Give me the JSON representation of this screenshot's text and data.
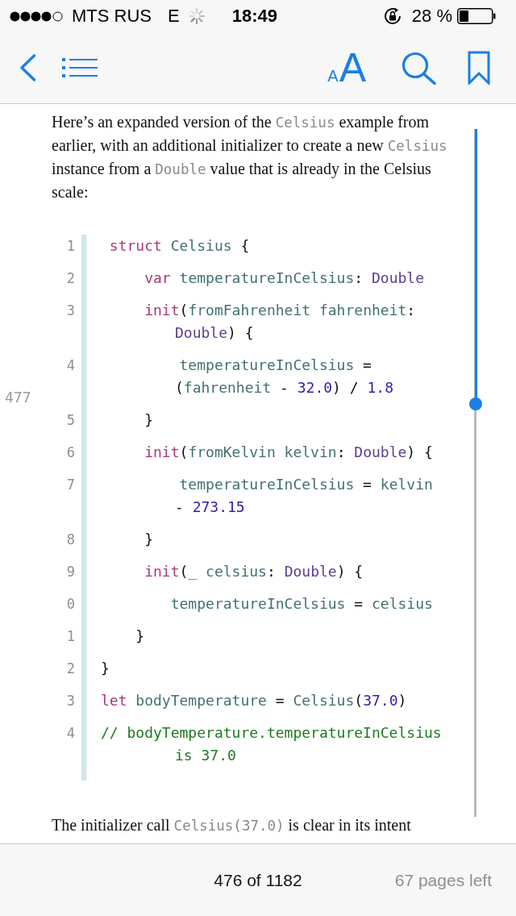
{
  "status_bar": {
    "carrier": "MTS RUS",
    "network": "E",
    "time": "18:49",
    "battery": "28 %"
  },
  "toolbar": {
    "text_size_button": {
      "small": "A",
      "large": "A"
    }
  },
  "page": {
    "blocks": [
      {
        "kind": "paragraph",
        "segments": [
          {
            "kind": "text",
            "text": "Here’s an expanded version of the "
          },
          {
            "kind": "code",
            "text": "Celsius"
          },
          {
            "kind": "text",
            "text": " example from earlier, with an additional initializer to create a new "
          },
          {
            "kind": "code",
            "text": "Celsius"
          },
          {
            "kind": "text",
            "text": " instance from a "
          },
          {
            "kind": "code",
            "text": "Double"
          },
          {
            "kind": "text",
            "text": " value that is already in the Celsius scale:"
          }
        ]
      },
      {
        "kind": "code",
        "lines": [
          {
            "number": "1",
            "rows": [
              {
                "tokens": [
                  {
                    "kind": "keyword",
                    "text": " struct"
                  },
                  {
                    "kind": "ident",
                    "text": " Celsius"
                  },
                  {
                    "kind": "plain",
                    "text": " {"
                  }
                ]
              }
            ]
          },
          {
            "number": "2",
            "rows": [
              {
                "tokens": [
                  {
                    "kind": "keyword",
                    "text": "     var"
                  },
                  {
                    "kind": "ident",
                    "text": " temperatureInCelsius"
                  },
                  {
                    "kind": "plain",
                    "text": ": "
                  },
                  {
                    "kind": "type",
                    "text": "Double"
                  }
                ]
              }
            ]
          },
          {
            "number": "3",
            "rows": [
              {
                "tokens": [
                  {
                    "kind": "keyword",
                    "text": "     init"
                  },
                  {
                    "kind": "plain",
                    "text": "("
                  },
                  {
                    "kind": "ident",
                    "text": "fromFahrenheit"
                  },
                  {
                    "kind": "ident",
                    "text": " fahrenheit"
                  },
                  {
                    "kind": "plain",
                    "text": ":"
                  }
                ]
              },
              {
                "tokens": [
                  {
                    "kind": "type",
                    "text": "Double"
                  },
                  {
                    "kind": "plain",
                    "text": ") {"
                  }
                ]
              }
            ]
          },
          {
            "number": "4",
            "rows": [
              {
                "tokens": [
                  {
                    "kind": "ident",
                    "text": "         temperatureInCelsius"
                  },
                  {
                    "kind": "plain",
                    "text": " ="
                  }
                ]
              },
              {
                "tokens": [
                  {
                    "kind": "plain",
                    "text": "("
                  },
                  {
                    "kind": "ident",
                    "text": "fahrenheit"
                  },
                  {
                    "kind": "plain",
                    "text": " - "
                  },
                  {
                    "kind": "number",
                    "text": "32.0"
                  },
                  {
                    "kind": "plain",
                    "text": ") / "
                  },
                  {
                    "kind": "number",
                    "text": "1.8"
                  }
                ]
              }
            ]
          },
          {
            "number": "5",
            "rows": [
              {
                "tokens": [
                  {
                    "kind": "plain",
                    "text": "     }"
                  }
                ]
              }
            ]
          },
          {
            "number": "6",
            "rows": [
              {
                "tokens": [
                  {
                    "kind": "keyword",
                    "text": "     init"
                  },
                  {
                    "kind": "plain",
                    "text": "("
                  },
                  {
                    "kind": "ident",
                    "text": "fromKelvin"
                  },
                  {
                    "kind": "ident",
                    "text": " kelvin"
                  },
                  {
                    "kind": "plain",
                    "text": ": "
                  },
                  {
                    "kind": "type",
                    "text": "Double"
                  },
                  {
                    "kind": "plain",
                    "text": ") {"
                  }
                ]
              }
            ]
          },
          {
            "number": "7",
            "rows": [
              {
                "tokens": [
                  {
                    "kind": "ident",
                    "text": "         temperatureInCelsius"
                  },
                  {
                    "kind": "plain",
                    "text": " = "
                  },
                  {
                    "kind": "ident",
                    "text": "kelvin"
                  }
                ]
              },
              {
                "tokens": [
                  {
                    "kind": "plain",
                    "text": "- "
                  },
                  {
                    "kind": "number",
                    "text": "273.15"
                  }
                ]
              }
            ]
          },
          {
            "number": "8",
            "rows": [
              {
                "tokens": [
                  {
                    "kind": "plain",
                    "text": "     }"
                  }
                ]
              }
            ]
          },
          {
            "number": "9",
            "rows": [
              {
                "tokens": [
                  {
                    "kind": "keyword",
                    "text": "     init"
                  },
                  {
                    "kind": "plain",
                    "text": "("
                  },
                  {
                    "kind": "keyword",
                    "text": "_"
                  },
                  {
                    "kind": "ident",
                    "text": " celsius"
                  },
                  {
                    "kind": "plain",
                    "text": ": "
                  },
                  {
                    "kind": "type",
                    "text": "Double"
                  },
                  {
                    "kind": "plain",
                    "text": ") {"
                  }
                ]
              }
            ]
          },
          {
            "number": "0",
            "rows": [
              {
                "tokens": [
                  {
                    "kind": "ident",
                    "text": "        temperatureInCelsius"
                  },
                  {
                    "kind": "plain",
                    "text": " = "
                  },
                  {
                    "kind": "ident",
                    "text": "celsius"
                  }
                ]
              }
            ]
          },
          {
            "number": "1",
            "rows": [
              {
                "tokens": [
                  {
                    "kind": "plain",
                    "text": "    }"
                  }
                ]
              }
            ]
          },
          {
            "number": "2",
            "rows": [
              {
                "tokens": [
                  {
                    "kind": "plain",
                    "text": "}"
                  }
                ]
              }
            ]
          },
          {
            "number": "3",
            "rows": [
              {
                "tokens": [
                  {
                    "kind": "keyword",
                    "text": "let"
                  },
                  {
                    "kind": "ident",
                    "text": " bodyTemperature"
                  },
                  {
                    "kind": "plain",
                    "text": " = "
                  },
                  {
                    "kind": "ident",
                    "text": "Celsius"
                  },
                  {
                    "kind": "plain",
                    "text": "("
                  },
                  {
                    "kind": "number",
                    "text": "37.0"
                  },
                  {
                    "kind": "plain",
                    "text": ")"
                  }
                ]
              }
            ]
          },
          {
            "number": "4",
            "rows": [
              {
                "tokens": [
                  {
                    "kind": "comment",
                    "text": "// bodyTemperature.temperatureInCelsius"
                  }
                ]
              },
              {
                "tokens": [
                  {
                    "kind": "comment",
                    "text": "is 37.0"
                  }
                ]
              }
            ]
          }
        ]
      },
      {
        "kind": "paragraph",
        "segments": [
          {
            "kind": "text",
            "text": "The initializer call "
          },
          {
            "kind": "code",
            "text": "Celsius(37.0)"
          },
          {
            "kind": "text",
            "text": " is clear in its intent"
          }
        ]
      }
    ],
    "page_marker": "477",
    "scrubber": {
      "level": 0.4
    }
  },
  "bottom_bar": {
    "location": "476 of 1182",
    "pages_left": "67 pages left"
  }
}
